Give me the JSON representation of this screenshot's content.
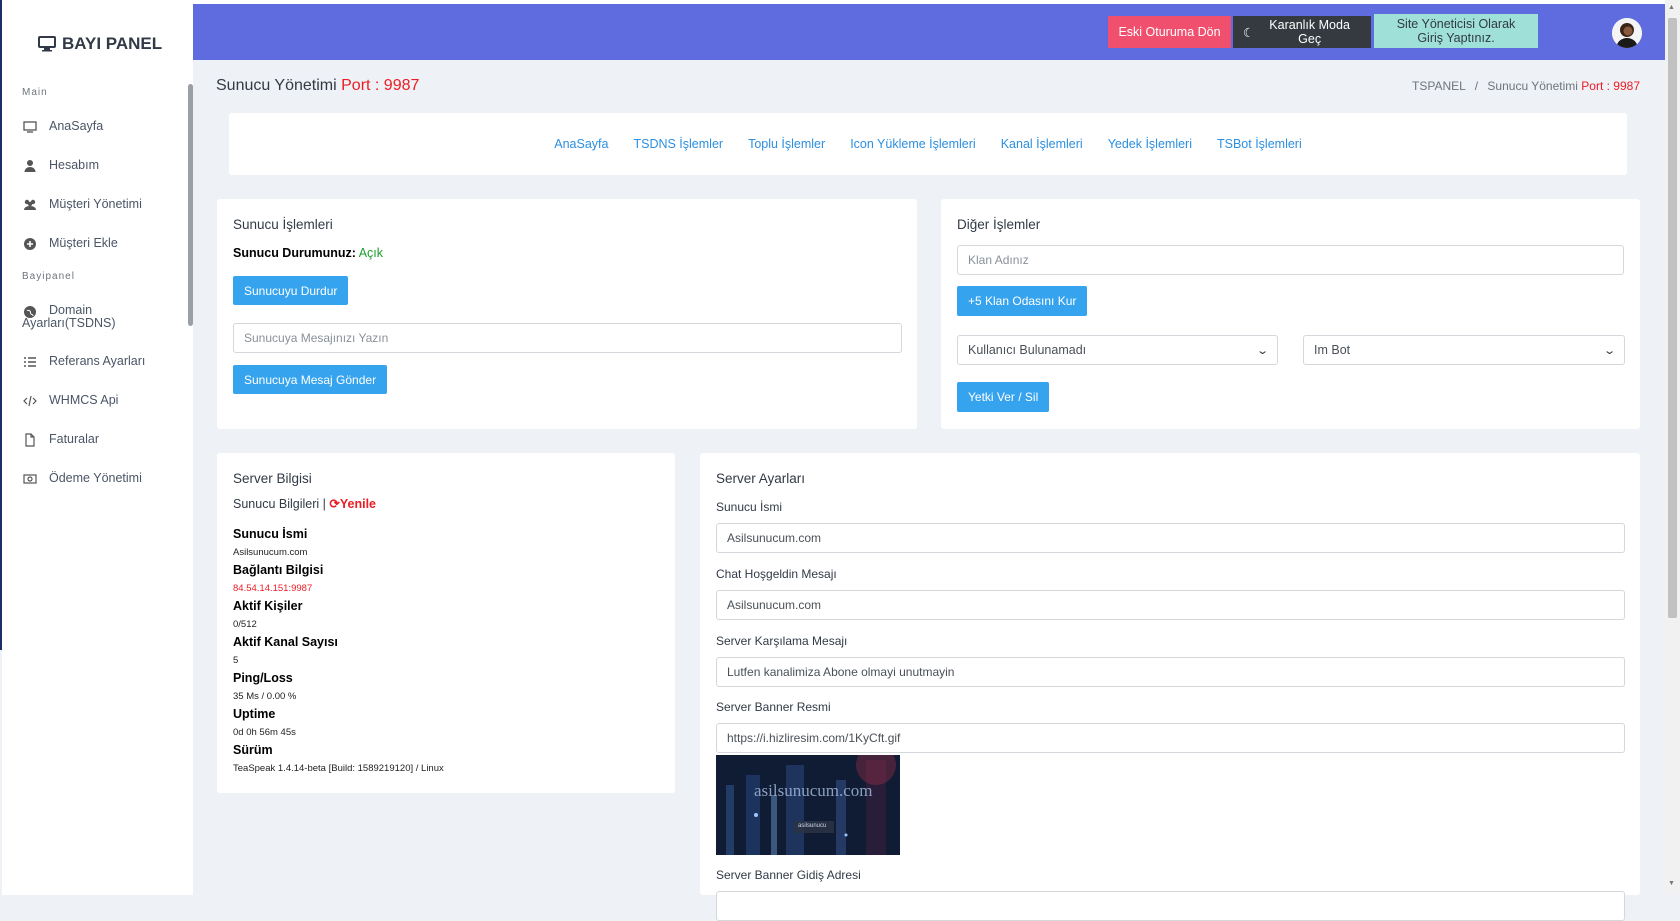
{
  "brand": {
    "title": "BAYI PANEL",
    "icon": "monitor-icon"
  },
  "sidebar": {
    "heading_main": "Main",
    "heading_bayi": "Bayipanel",
    "items": [
      {
        "label": "AnaSayfa",
        "icon": "monitor-icon"
      },
      {
        "label": "Hesabım",
        "icon": "user-icon"
      },
      {
        "label": "Müşteri Yönetimi",
        "icon": "users-icon"
      },
      {
        "label": "Müşteri Ekle",
        "icon": "plus-circle-icon"
      },
      {
        "label": "Domain Ayarları(TSDNS)",
        "icon": "globe-icon"
      },
      {
        "label": "Referans Ayarları",
        "icon": "list-icon"
      },
      {
        "label": "WHMCS Api",
        "icon": "code-icon"
      },
      {
        "label": "Faturalar",
        "icon": "file-icon"
      },
      {
        "label": "Ödeme Yönetimi",
        "icon": "money-icon"
      }
    ]
  },
  "topbar": {
    "return_session": "Eski Oturuma Dön",
    "dark_mode": "Karanlık Moda Geç",
    "admin_login": "Site Yöneticisi Olarak Giriş Yaptınız."
  },
  "page": {
    "title": "Sunucu Yönetimi",
    "port_label": "Port : 9987",
    "breadcrumb_root": "TSPANEL",
    "breadcrumb_current": "Sunucu Yönetimi",
    "breadcrumb_port": "Port : 9987"
  },
  "nav": [
    "AnaSayfa",
    "TSDNS İşlemler",
    "Toplu İşlemler",
    "Icon Yükleme İşlemleri",
    "Kanal İşlemleri",
    "Yedek İşlemleri",
    "TSBot İşlemleri"
  ],
  "server_ops": {
    "title": "Sunucu İşlemleri",
    "status_label": "Sunucu Durumunuz:",
    "status_value": "Açık",
    "stop_button": "Sunucuyu Durdur",
    "message_placeholder": "Sunucuya Mesajınızı Yazın",
    "send_button": "Sunucuya Mesaj Gönder"
  },
  "other_ops": {
    "title": "Diğer İşlemler",
    "clan_placeholder": "Klan Adınız",
    "clan_button": "+5 Klan Odasını Kur",
    "user_select": "Kullanıcı Bulunamadı",
    "role_select": "Im Bot",
    "perm_button": "Yetki Ver / Sil"
  },
  "server_info": {
    "title": "Server Bilgisi",
    "subtitle": "Sunucu Bilgileri |",
    "refresh": "Yenile",
    "fields": [
      {
        "label": "Sunucu İsmi",
        "value": "Asilsunucum.com"
      },
      {
        "label": "Bağlantı Bilgisi",
        "value": "84.54.14.151:9987"
      },
      {
        "label": "Aktif Kişiler",
        "value": "0/512"
      },
      {
        "label": "Aktif Kanal Sayısı",
        "value": "5"
      },
      {
        "label": "Ping/Loss",
        "value": "35 Ms / 0.00 %"
      },
      {
        "label": "Uptime",
        "value": "0d 0h 56m 45s"
      },
      {
        "label": "Sürüm",
        "value": "TeaSpeak 1.4.14-beta [Build: 1589219120] / Linux"
      }
    ]
  },
  "server_settings": {
    "title": "Server Ayarları",
    "name_label": "Sunucu İsmi",
    "name_value": "Asilsunucum.com",
    "welcome_label": "Chat Hoşgeldin Mesajı",
    "welcome_value": "Asilsunucum.com",
    "greeting_label": "Server Karşılama Mesajı",
    "greeting_value": "Lutfen kanalimiza Abone olmayi unutmayin",
    "banner_label": "Server Banner Resmi",
    "banner_value": "https://i.hizliresim.com/1KyCft.gif",
    "banner_image_text": "asilsunucum.com",
    "banner_image_small": "asilsunucu",
    "banner_link_label": "Server Banner Gidiş Adresi"
  },
  "colors": {
    "topbar": "#5f6ce0",
    "primary": "#35a3ee",
    "danger": "#f0506e",
    "dark": "#343a40",
    "success_badge": "#9fe0d8"
  }
}
